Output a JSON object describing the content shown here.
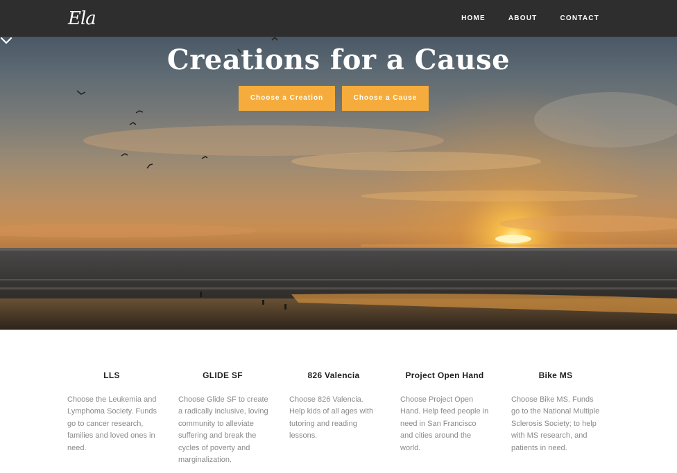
{
  "nav": {
    "logo": "Ela",
    "links": [
      "HOME",
      "ABOUT",
      "CONTACT"
    ]
  },
  "hero": {
    "title": "Creations for a Cause",
    "buttons": {
      "creation": "Choose a Creation",
      "cause": "Choose a Cause"
    },
    "scroll_icon": "chevron-down-icon"
  },
  "causes": [
    {
      "title": "LLS",
      "description": "Choose the Leukemia and Lymphoma Society. Funds go to cancer research, families and loved ones in need."
    },
    {
      "title": "GLIDE SF",
      "description": "Choose Glide SF to create a radically inclusive, loving community to alleviate suffering and break the cycles of poverty and marginalization."
    },
    {
      "title": "826 Valencia",
      "description": "Choose 826 Valencia. Help kids of all ages with tutoring and reading lessons."
    },
    {
      "title": "Project Open Hand",
      "description": "Choose Project Open Hand. Help feed people in need in San Francisco and cities around the world."
    },
    {
      "title": "Bike MS",
      "description": "Choose Bike MS. Funds go to the National Multiple Sclerosis Society; to help with MS research, and patients in need."
    }
  ],
  "colors": {
    "navbar": "#2e2e2e",
    "button": "#f5ac3d",
    "text_dark": "#1e1e1e",
    "text_muted": "#8a8a8a"
  }
}
